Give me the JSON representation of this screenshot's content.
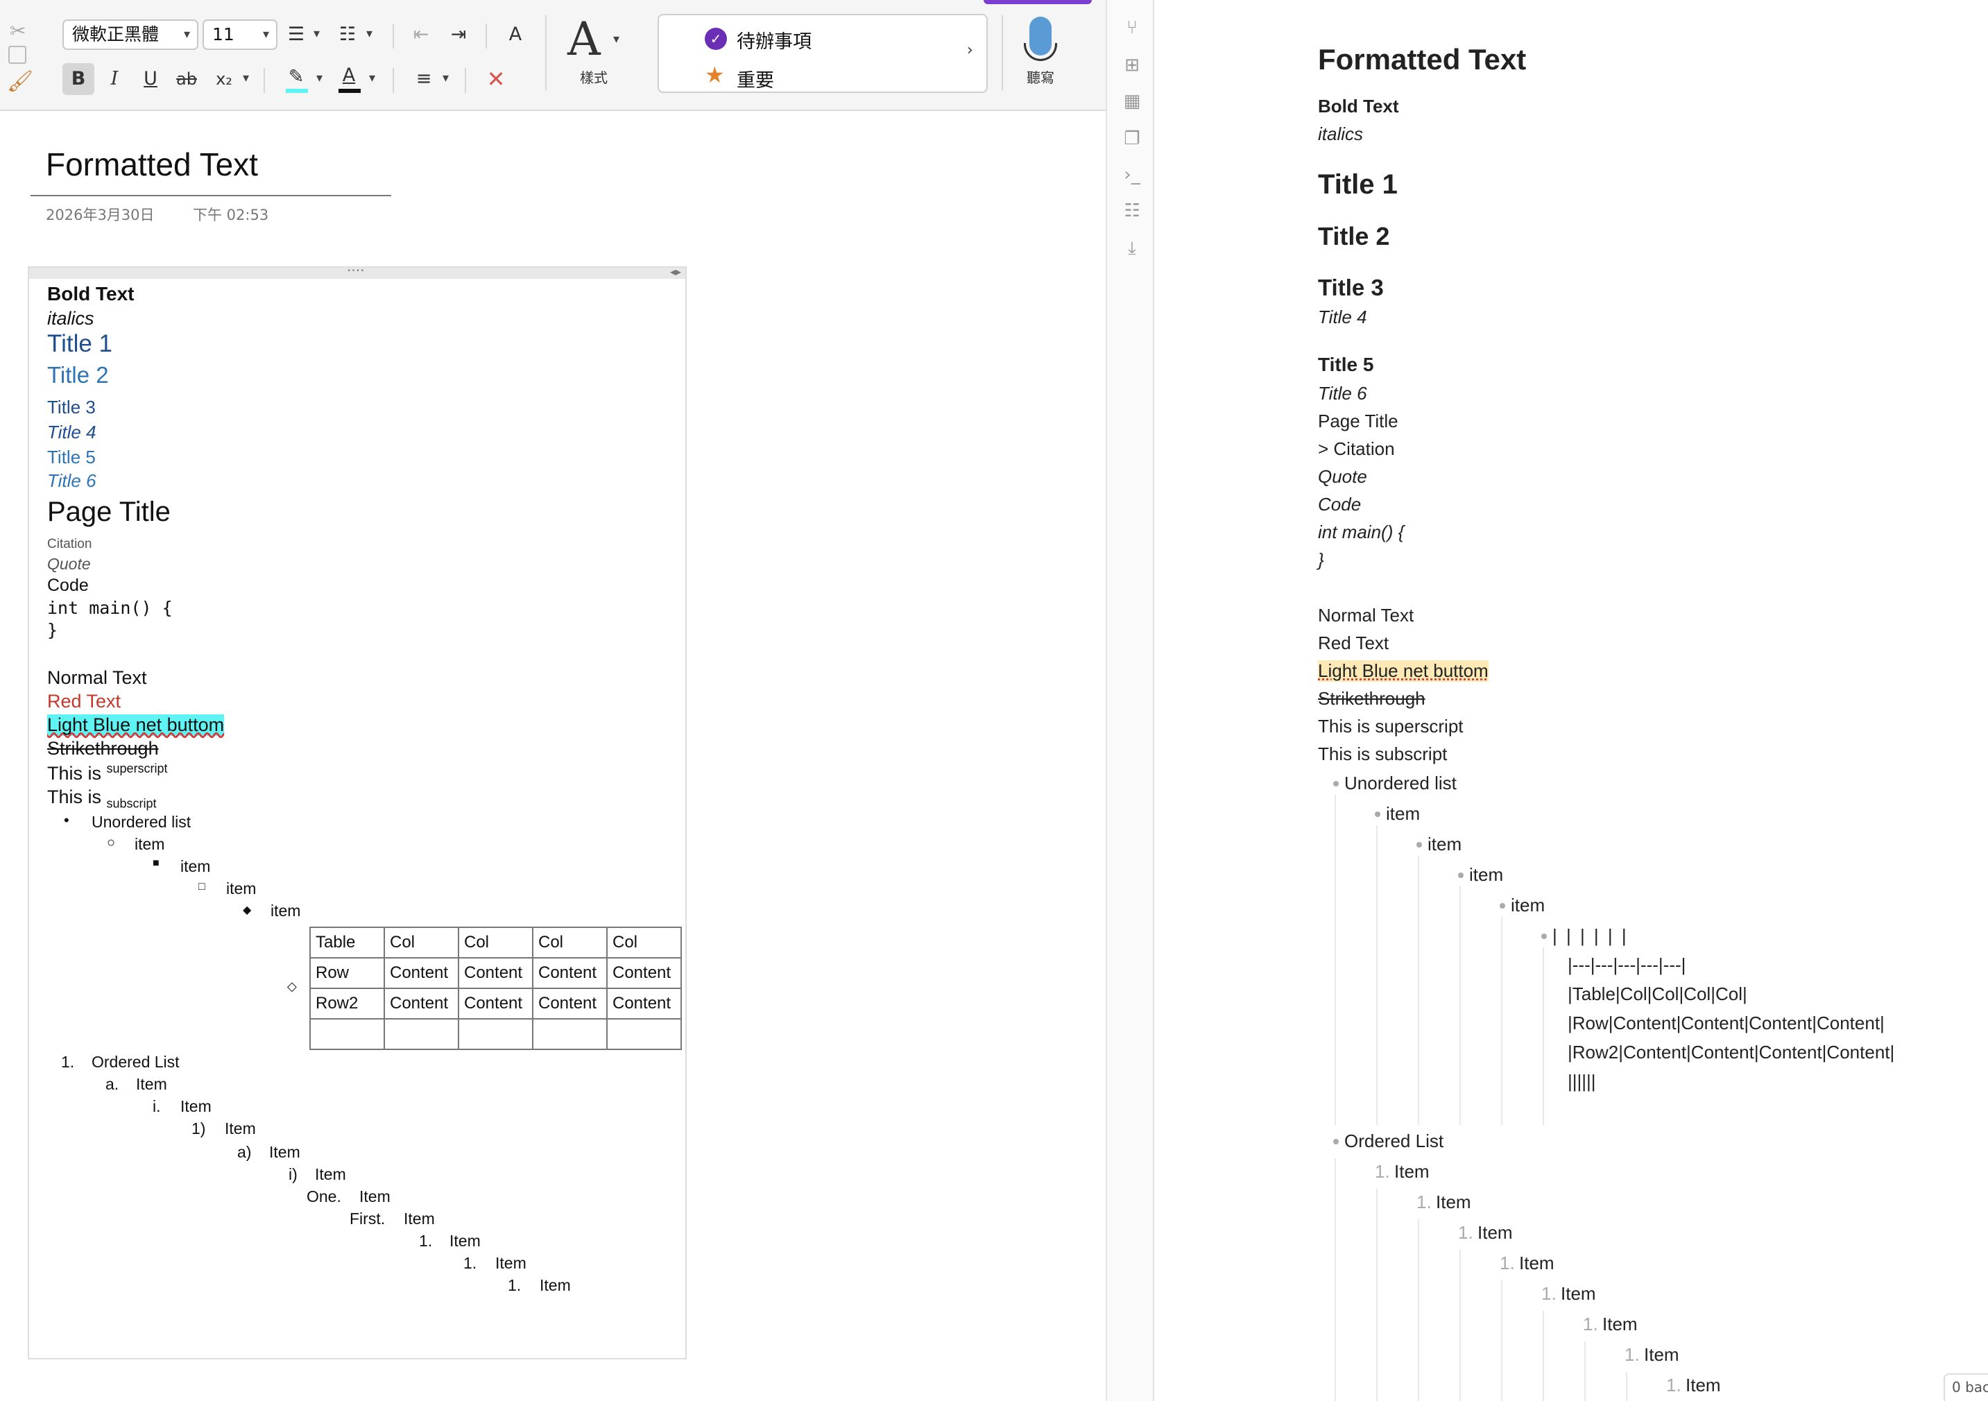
{
  "ribbon": {
    "font_name": "微軟正黑體",
    "font_size": "11",
    "bold": "B",
    "italic": "I",
    "underline": "U",
    "strike": "ab",
    "subscript": "x₂",
    "styles_label": "樣式",
    "tags": [
      {
        "label": "待辦事項",
        "icon": "check-circle-icon",
        "color": "#6b2fb5"
      },
      {
        "label": "重要",
        "icon": "star-icon",
        "color": "#e3832b"
      }
    ],
    "dictate_label": "聽寫"
  },
  "page": {
    "title": "Formatted Text",
    "date": "2026年3月30日",
    "time": "下午 02:53",
    "content": {
      "bold": "Bold Text",
      "italics": "italics",
      "t1": "Title 1",
      "t2": "Title 2",
      "t3": "Title 3",
      "t4": "Title 4",
      "t5": "Title 5",
      "t6": "Title 6",
      "page_title": "Page Title",
      "citation": "Citation",
      "quote": "Quote",
      "code": "Code",
      "code1": "int main() {",
      "code2": "}",
      "normal": "Normal Text",
      "red": "Red Text",
      "highlight": "Light Blue net buttom",
      "strike": "Strikethrough",
      "sup_base": "This is",
      "sup": "superscript",
      "sub_base": "This is",
      "sub": "subscript",
      "ul_head": "Unordered list",
      "ul_items": [
        "item",
        "item",
        "item",
        "item"
      ],
      "table": [
        [
          "Table",
          "Col",
          "Col",
          "Col",
          "Col"
        ],
        [
          "Row",
          "Content",
          "Content",
          "Content",
          "Content"
        ],
        [
          "Row2",
          "Content",
          "Content",
          "Content",
          "Content"
        ],
        [
          "",
          "",
          "",
          "",
          ""
        ]
      ],
      "ol_head_marker": "1.",
      "ol_head": "Ordered List",
      "ol_items": [
        {
          "m": "a.",
          "t": "Item"
        },
        {
          "m": "i.",
          "t": "Item"
        },
        {
          "m": "1)",
          "t": "Item"
        },
        {
          "m": "a)",
          "t": "Item"
        },
        {
          "m": "i)",
          "t": "Item"
        },
        {
          "m": "One.",
          "t": "Item"
        },
        {
          "m": "First.",
          "t": "Item"
        },
        {
          "m": "1.",
          "t": "Item"
        },
        {
          "m": "1.",
          "t": "Item"
        },
        {
          "m": "1.",
          "t": "Item"
        }
      ]
    }
  },
  "colors": {
    "title_blue": "#1e4e8c",
    "title_blue_light": "#2e74b5",
    "red": "#c0392b",
    "cyan": "#5ff3f3",
    "md_highlight": "#fde9b6",
    "accent_purple": "#7b3fd0"
  },
  "markdown": {
    "heading": "Formatted Text",
    "bold": "Bold Text",
    "italics": "italics",
    "t1": "Title 1",
    "t2": "Title 2",
    "t3": "Title 3",
    "t4": "Title 4",
    "t5": "Title 5",
    "t6": "Title 6",
    "page_title": "Page Title",
    "citation": "> Citation",
    "quote": "Quote",
    "code": "Code",
    "code1": "int main() {",
    "code2": "}",
    "normal": "Normal Text",
    "red": "Red Text",
    "highlight": "Light Blue net buttom",
    "strike": "Strikethrough",
    "sup": "This is superscript",
    "sub": "This is subscript",
    "ul_head": "Unordered list",
    "ul_items": [
      "item",
      "item",
      "item",
      "item"
    ],
    "table_lines": [
      "| | | | | |",
      "|---|---|---|---|---|",
      "|Table|Col|Col|Col|Col|",
      "|Row|Content|Content|Content|Content|",
      "|Row2|Content|Content|Content|Content|",
      "||||||"
    ],
    "ol_head": "Ordered List",
    "ol_marker": "1.",
    "ol_items": [
      "Item",
      "Item",
      "Item",
      "Item",
      "Item",
      "Item",
      "Item",
      "Item"
    ],
    "status": "0 bac"
  }
}
